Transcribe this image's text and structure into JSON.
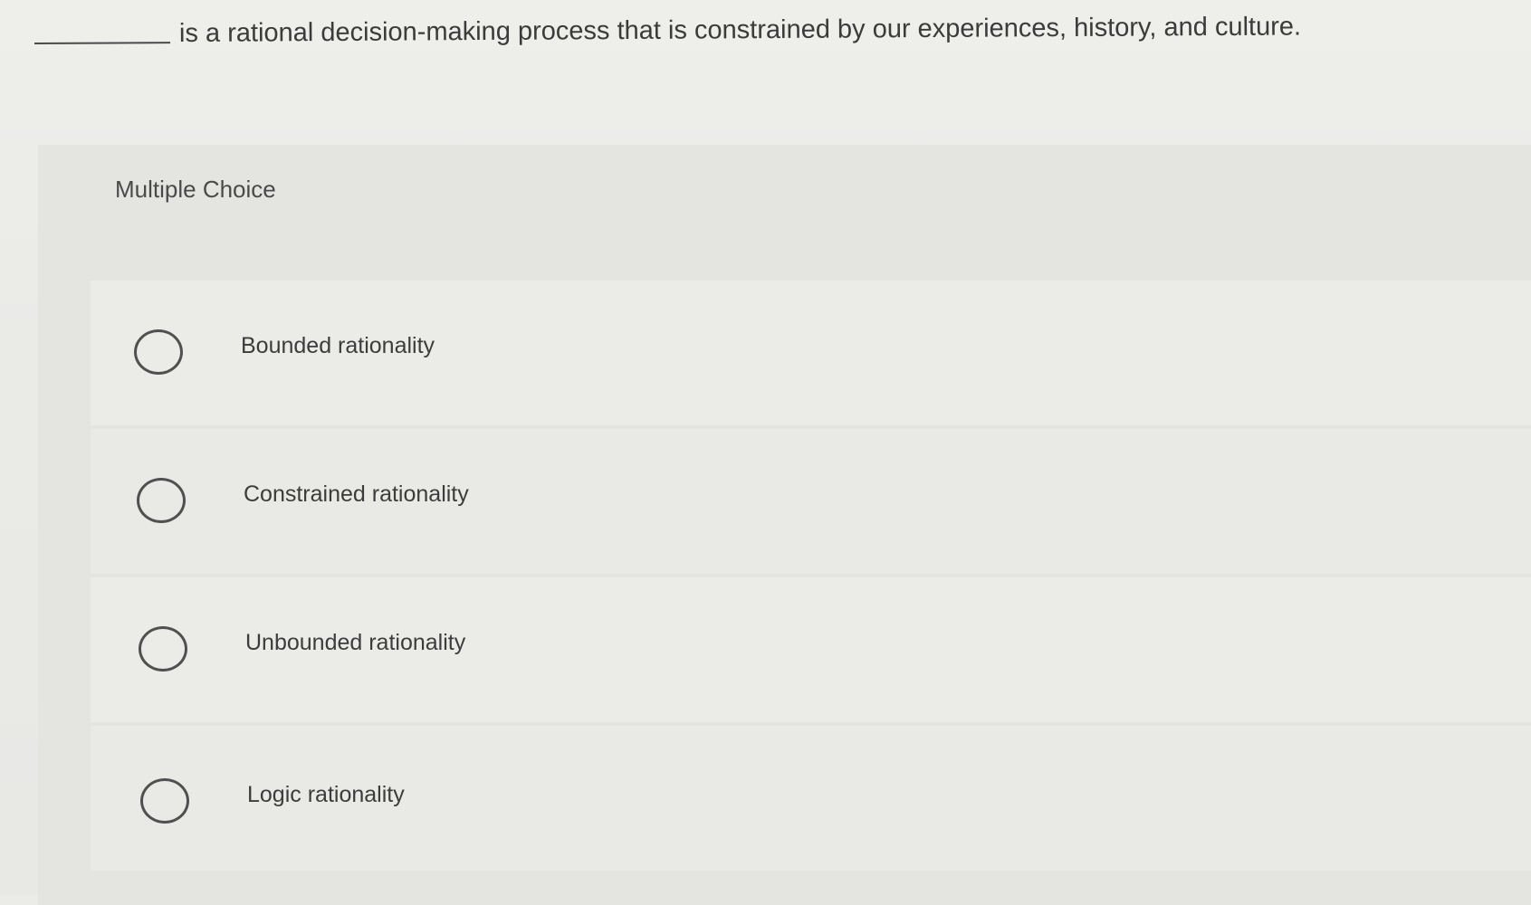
{
  "question": {
    "text": "is a rational decision-making process that is constrained by our experiences, history, and culture."
  },
  "section": {
    "type_label": "Multiple Choice"
  },
  "choices": [
    {
      "label": "Bounded rationality",
      "selected": false
    },
    {
      "label": "Constrained rationality",
      "selected": false
    },
    {
      "label": "Unbounded rationality",
      "selected": false
    },
    {
      "label": "Logic rationality",
      "selected": false
    }
  ]
}
